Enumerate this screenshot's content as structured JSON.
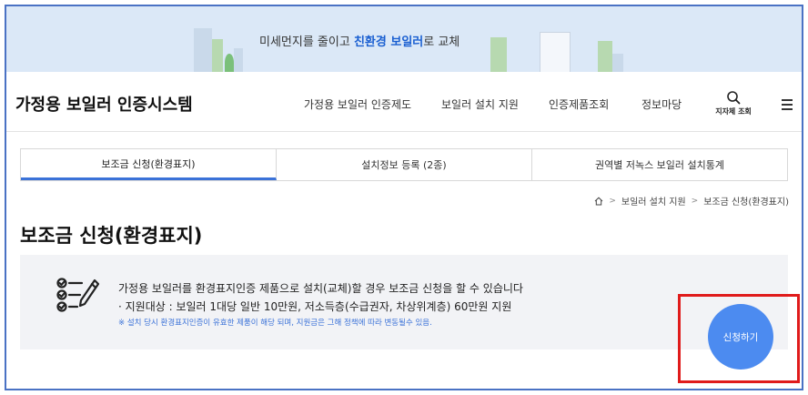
{
  "banner": {
    "text_before": "미세먼지를 줄이고 ",
    "text_highlight": "친환경 보일러",
    "text_after": "로 교체"
  },
  "header": {
    "logo": "가정용 보일러 인증시스템",
    "nav": [
      {
        "label": "가정용 보일러 인증제도"
      },
      {
        "label": "보일러 설치 지원"
      },
      {
        "label": "인증제품조회"
      },
      {
        "label": "정보마당"
      }
    ],
    "search_label": "지자체 조회"
  },
  "tabs": [
    {
      "label": "보조금 신청(환경표지)",
      "active": true
    },
    {
      "label": "설치정보 등록 (2종)",
      "active": false
    },
    {
      "label": "권역별 저녹스 보일러 설치통계",
      "active": false
    }
  ],
  "breadcrumb": {
    "items": [
      "보일러 설치 지원",
      "보조금 신청(환경표지)"
    ],
    "separator": ">"
  },
  "page": {
    "title": "보조금 신청(환경표지)"
  },
  "info": {
    "main": "가정용 보일러를 환경표지인증 제품으로 설치(교체)할 경우 보조금 신청을 할 수 있습니다",
    "sub": "· 지원대상 : 보일러 1대당 일반 10만원, 저소득층(수급권자, 차상위계층) 60만원 지원",
    "note": "※ 설치 당시 환경표지인증이 유효한 제품이 해당 되며, 지원금은 그해 정책에 따라 변동될수 있음."
  },
  "apply": {
    "label": "신청하기"
  },
  "colors": {
    "accent": "#4c8bf0",
    "tab_active": "#3b72d8",
    "highlight_box": "#e01b1b",
    "banner_bg": "#dbe8f7"
  }
}
